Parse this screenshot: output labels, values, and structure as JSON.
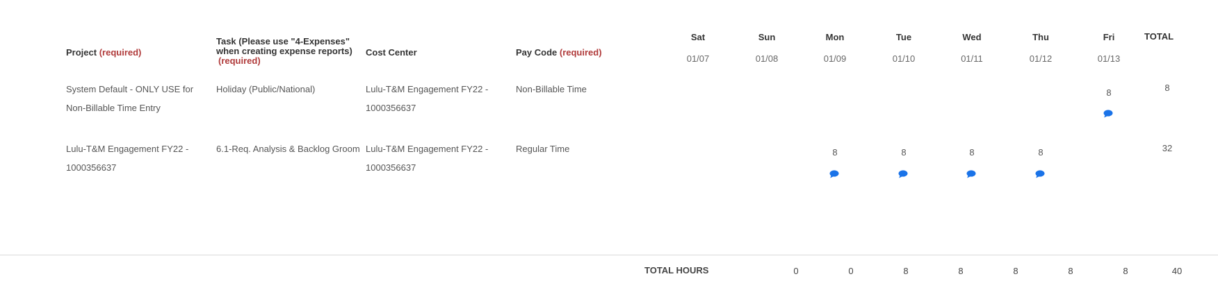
{
  "headers": {
    "project": "Project",
    "project_req": "(required)",
    "task_line1": "Task (Please use \"4-Expenses\"",
    "task_line2": "when creating expense reports)",
    "task_req": "(required)",
    "cost_center": "Cost Center",
    "pay_code": "Pay Code",
    "pay_code_req": "(required)",
    "total": "TOTAL"
  },
  "days": [
    {
      "name": "Sat",
      "date": "01/07"
    },
    {
      "name": "Sun",
      "date": "01/08"
    },
    {
      "name": "Mon",
      "date": "01/09"
    },
    {
      "name": "Tue",
      "date": "01/10"
    },
    {
      "name": "Wed",
      "date": "01/11"
    },
    {
      "name": "Thu",
      "date": "01/12"
    },
    {
      "name": "Fri",
      "date": "01/13"
    }
  ],
  "rows": [
    {
      "project_line1": "System Default - ONLY USE for",
      "project_line2": "Non-Billable Time Entry",
      "task": "Holiday (Public/National)",
      "cost_center_line1": "Lulu-T&M Engagement FY22 -",
      "cost_center_line2": "1000356637",
      "pay_code": "Non-Billable Time",
      "hours": {
        "fri": "8"
      },
      "total": "8"
    },
    {
      "project_line1": "Lulu-T&M Engagement FY22 -",
      "project_line2": "1000356637",
      "task": "6.1-Req. Analysis & Backlog Groom",
      "cost_center_line1": "Lulu-T&M Engagement FY22 -",
      "cost_center_line2": "1000356637",
      "pay_code": "Regular Time",
      "hours": {
        "mon": "8",
        "tue": "8",
        "wed": "8",
        "thu": "8"
      },
      "total": "32"
    }
  ],
  "footer": {
    "label": "TOTAL HOURS",
    "values": [
      "0",
      "0",
      "8",
      "8",
      "8",
      "8",
      "8"
    ],
    "grand_total": "40"
  },
  "colors": {
    "required": "#b03a3a",
    "comment_icon": "#1a73e8"
  },
  "icons": {
    "comment": "speech-bubble-icon"
  }
}
